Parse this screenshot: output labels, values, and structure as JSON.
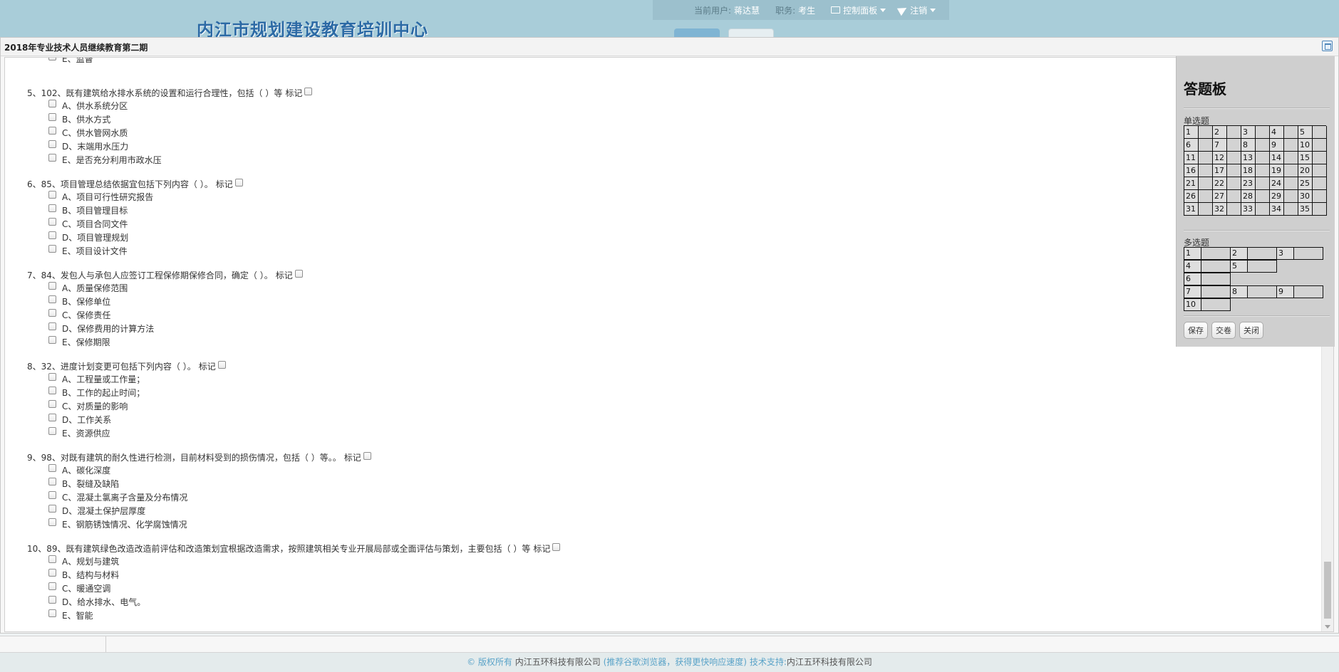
{
  "header": {
    "logo_text": "内江市规划建设教育培训中心",
    "current_user_label": "当前用户:",
    "current_user": "蒋达慧",
    "role_label": "职务:",
    "role": "考生",
    "control_panel": "控制面板",
    "logout": "注销"
  },
  "dialog": {
    "title": "2018年专业技术人员继续教育第二期"
  },
  "mark_label": "标记",
  "questions": [
    {
      "title": "",
      "options": [
        "E、监督"
      ]
    },
    {
      "title": "5、102、既有建筑给水排水系统的设置和运行合理性，包括（ ）等",
      "options": [
        "A、供水系统分区",
        "B、供水方式",
        "C、供水管网水质",
        "D、末端用水压力",
        "E、是否充分利用市政水压"
      ]
    },
    {
      "title": "6、85、项目管理总结依据宜包括下列内容（ ）。",
      "options": [
        "A、项目可行性研究报告",
        "B、项目管理目标",
        "C、项目合同文件",
        "D、项目管理规划",
        "E、项目设计文件"
      ]
    },
    {
      "title": "7、84、发包人与承包人应签订工程保修期保修合同，确定（ ）。",
      "options": [
        "A、质量保修范围",
        "B、保修单位",
        "C、保修责任",
        "D、保修费用的计算方法",
        "E、保修期限"
      ]
    },
    {
      "title": "8、32、进度计划变更可包括下列内容（ ）。",
      "options": [
        "A、工程量或工作量；",
        "B、工作的起止时间；",
        "C、对质量的影响",
        "D、工作关系",
        "E、资源供应"
      ]
    },
    {
      "title": "9、98、对既有建筑的耐久性进行检测，目前材料受到的损伤情况，包括（ ）等。。",
      "options": [
        "A、碳化深度",
        "B、裂缝及缺陷",
        "C、混凝土氯离子含量及分布情况",
        "D、混凝土保护层厚度",
        "E、钢筋锈蚀情况、化学腐蚀情况"
      ]
    },
    {
      "title": "10、89、既有建筑绿色改造改造前评估和改造策划宜根据改造需求，按照建筑相关专业开展局部或全面评估与策划，主要包括（ ）等",
      "options": [
        "A、规划与建筑",
        "B、结构与材料",
        "C、暖通空调",
        "D、给水排水、电气。",
        "E、智能"
      ]
    }
  ],
  "answer_board": {
    "title": "答题板",
    "single_label": "单选题",
    "single_numbers": [
      "1",
      "2",
      "3",
      "4",
      "5",
      "6",
      "7",
      "8",
      "9",
      "10",
      "11",
      "12",
      "13",
      "14",
      "15",
      "16",
      "17",
      "18",
      "19",
      "20",
      "21",
      "22",
      "23",
      "24",
      "25",
      "26",
      "27",
      "28",
      "29",
      "30",
      "31",
      "32",
      "33",
      "34",
      "35"
    ],
    "multi_label": "多选题",
    "multi_rows": [
      [
        "1",
        "2",
        "3"
      ],
      [
        "4",
        "5"
      ],
      [
        "6"
      ],
      [
        "7",
        "8",
        "9"
      ],
      [
        "10"
      ]
    ],
    "buttons": {
      "save": "保存",
      "submit": "交卷",
      "close": "关闭"
    }
  },
  "footer": {
    "copyright": "© 版权所有",
    "company": "内江五环科技有限公司",
    "browser_tip": "(推荐谷歌浏览器，获得更快响应速度)",
    "support_label": "技术支持:",
    "support_company": "内江五环科技有限公司"
  }
}
